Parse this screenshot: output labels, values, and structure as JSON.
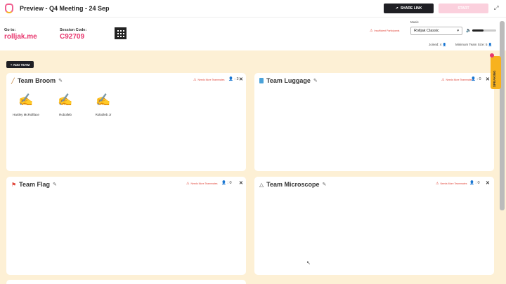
{
  "header": {
    "title": "Preview - Q4 Meeting - 24 Sep",
    "share_label": "SHARE LINK",
    "start_label": "START"
  },
  "session": {
    "goto_label": "Go to:",
    "goto_value": "rolljak.me",
    "code_label": "Session Code:",
    "code_value": "C92709",
    "warning": "Insufficient Participants"
  },
  "music": {
    "label": "Music",
    "selected": "Rolljak Classic",
    "volume_fraction": 0.47
  },
  "stats": {
    "joined_label": "Joined:",
    "joined_value": "4",
    "min_team_label": "Minimum Team Size:",
    "min_team_value": "5"
  },
  "add_team_label": "+ ADD TEAM",
  "side_tab_label": "SPEAKING",
  "teams": [
    {
      "name": "Team Broom",
      "icon": "broom-icon",
      "warning": "Needs More Teammates",
      "count": "3",
      "members": [
        "Hartley McRollface",
        "Robolleb",
        "Robolleb Jr"
      ]
    },
    {
      "name": "Team Luggage",
      "icon": "luggage-icon",
      "warning": "Needs More Teammates",
      "count": "0",
      "members": []
    },
    {
      "name": "Team Flag",
      "icon": "flag-icon",
      "warning": "Needs More Teammates",
      "count": "0",
      "members": []
    },
    {
      "name": "Team Microscope",
      "icon": "microscope-icon",
      "warning": "Needs More Teammates",
      "count": "0",
      "members": []
    }
  ]
}
